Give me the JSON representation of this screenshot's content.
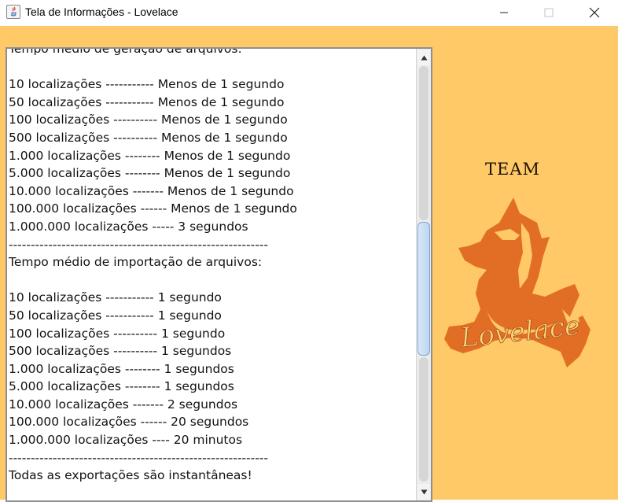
{
  "window": {
    "title": "Tela de Informações - Lovelace",
    "controls": {
      "minimize": "minimize-icon",
      "maximize": "maximize-icon",
      "close": "close-icon"
    }
  },
  "colors": {
    "background": "#fec966",
    "logo": "#e26e25",
    "text_panel": "#ffffff"
  },
  "info_lines": [
    "Tempo médio de geração de arquivos:",
    "",
    "10 localizações ----------- Menos de 1 segundo",
    "50 localizações ----------- Menos de 1 segundo",
    "100 localizações ---------- Menos de 1 segundo",
    "500 localizações ---------- Menos de 1 segundo",
    "1.000 localizações -------- Menos de 1 segundo",
    "5.000 localizações -------- Menos de 1 segundo",
    "10.000 localizações ------- Menos de 1 segundo",
    "100.000 localizações ------ Menos de 1 segundo",
    "1.000.000 localizações ----- 3 segundos",
    "-----------------------------------------------------------",
    "Tempo médio de importação de arquivos:",
    "",
    "10 localizações ----------- 1 segundo",
    "50 localizações ----------- 1 segundo",
    "100 localizações ---------- 1 segundo",
    "500 localizações ---------- 1 segundos",
    "1.000 localizações -------- 1 segundos",
    "5.000 localizações -------- 1 segundos",
    "10.000 localizações ------- 2 segundos",
    "100.000 localizações ------ 20 segundos",
    "1.000.000 localizações ---- 20 minutos",
    "-----------------------------------------------------------",
    "Todas as exportações são instantâneas!"
  ],
  "logo": {
    "team": "TEAM",
    "name": "Lovelace"
  }
}
